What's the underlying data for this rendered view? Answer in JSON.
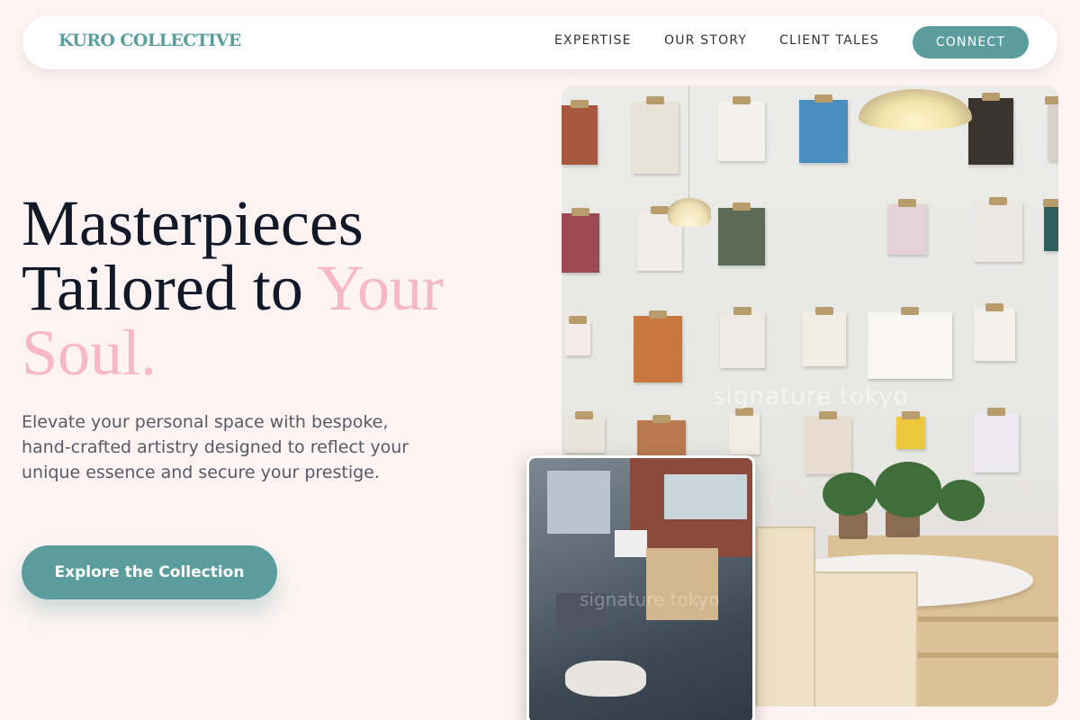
{
  "nav": {
    "logo": "KURO COLLECTIVE",
    "links": [
      "EXPERTISE",
      "OUR STORY",
      "CLIENT TALES"
    ],
    "cta": "CONNECT"
  },
  "hero": {
    "headline_line1": "Masterpieces",
    "headline_line2": "Tailored to ",
    "headline_accent1": "Your",
    "headline_accent2": "Soul.",
    "subtext": "Elevate your personal space with bespoke, hand-crafted artistry designed to reflect your unique essence and secure your prestige.",
    "cta_label": "Explore the Collection"
  },
  "images": {
    "main_watermark": "signature tokyo",
    "inset_watermark": "signature tokyo"
  },
  "colors": {
    "background": "#fdf3f3",
    "accent_teal": "#5b9d9c",
    "accent_pink": "#f6b7c6",
    "headline": "#111827"
  }
}
